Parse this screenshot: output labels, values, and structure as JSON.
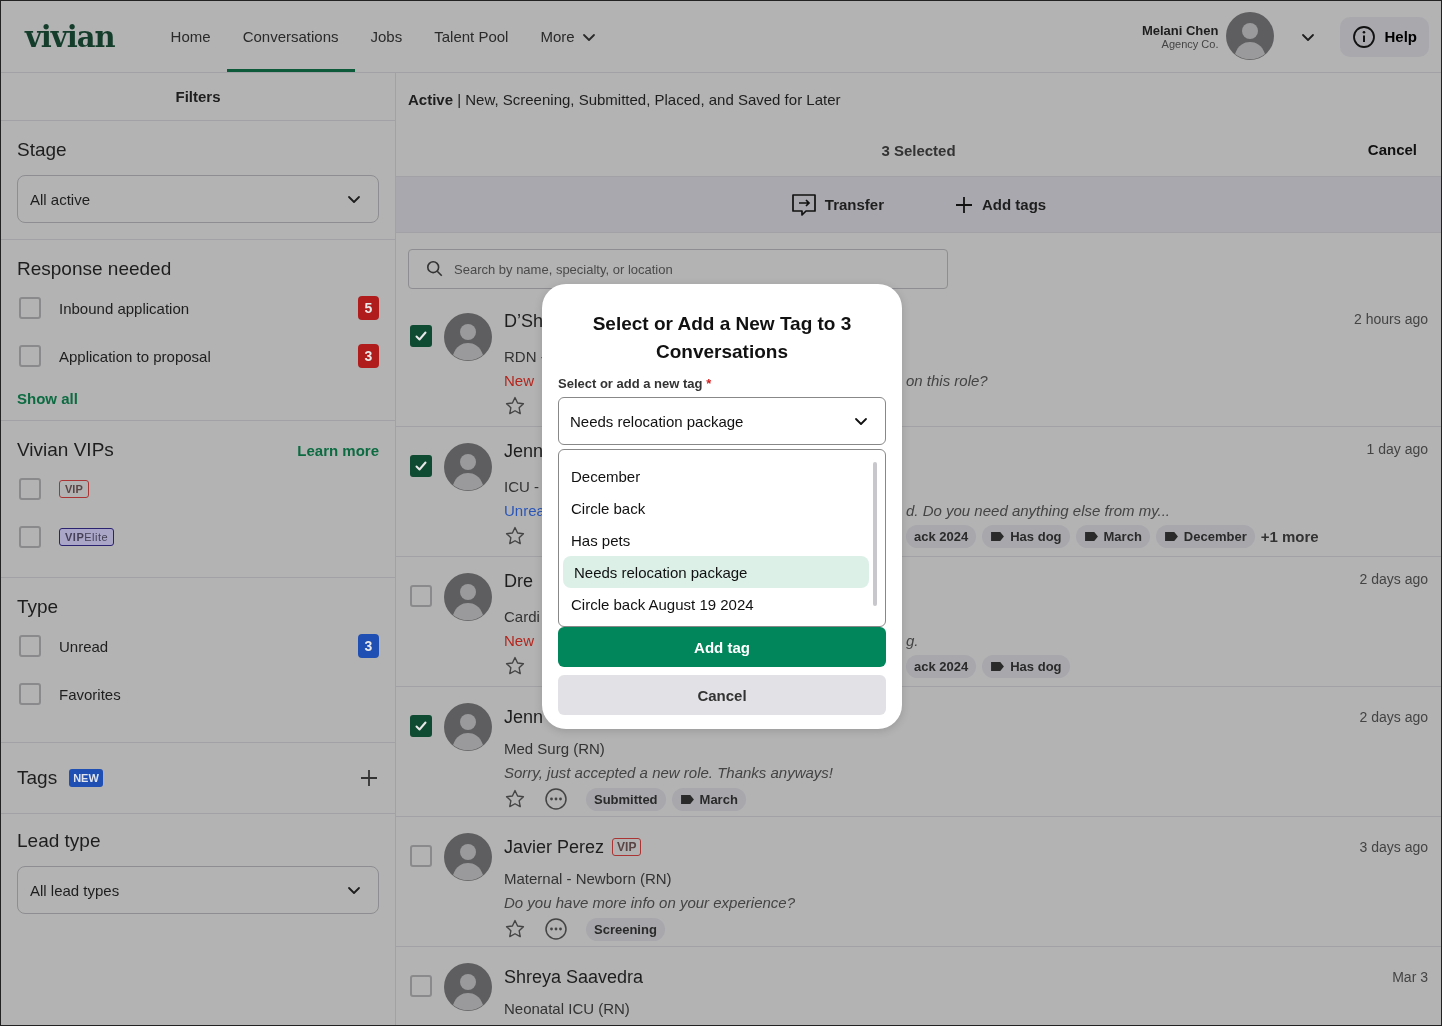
{
  "header": {
    "logo": "vivian",
    "nav": [
      {
        "label": "Home",
        "selected": false,
        "kind": "link"
      },
      {
        "label": "Conversations",
        "selected": true,
        "kind": "link"
      },
      {
        "label": "Jobs",
        "selected": false,
        "kind": "link"
      },
      {
        "label": "Talent Pool",
        "selected": false,
        "kind": "link"
      },
      {
        "label": "More",
        "selected": false,
        "kind": "menu"
      }
    ],
    "user": {
      "name": "Melani Chen",
      "org": "Agency Co."
    },
    "help": "Help"
  },
  "filters": {
    "title": "Filters",
    "stage": {
      "heading": "Stage",
      "value": "All active"
    },
    "response_needed": {
      "heading": "Response needed",
      "link": "Show all",
      "items": [
        {
          "label": "Inbound application",
          "checked": false,
          "count": "5",
          "color": "#b01c1c"
        },
        {
          "label": "Application to proposal",
          "checked": false,
          "count": "3",
          "color": "#b01c1c"
        }
      ]
    },
    "vips": {
      "heading": "Vivian VIPs",
      "link": "Learn more",
      "items": [
        {
          "label": "VIP",
          "checked": false,
          "kind": "vip"
        },
        {
          "label": "**VIP**Elite",
          "checked": false,
          "kind": "elite"
        }
      ]
    },
    "type": {
      "heading": "Type",
      "items": [
        {
          "label": "Unread",
          "checked": false,
          "count": "3",
          "color": "#1f4fb3"
        },
        {
          "label": "Favorites",
          "checked": false
        }
      ]
    },
    "tags": {
      "heading": "Tags",
      "badge": "NEW"
    },
    "lead_type": {
      "heading": "Lead type",
      "value": "All lead types"
    }
  },
  "main": {
    "breadcrumb": "**Active** | New, Screening, Submitted, Placed, and Saved for Later",
    "selection": {
      "count": "3 Selected",
      "cancel": "Cancel"
    },
    "actions": [
      {
        "label": "Transfer",
        "kind": "transfer"
      },
      {
        "label": "Add tags",
        "kind": "add"
      }
    ],
    "search": {
      "placeholder": "Search by name, specialty, or location"
    },
    "conversations": [
      {
        "kind": "covered",
        "selected": true,
        "starred": false,
        "name": "D’Sh",
        "subtitle": "RDN -",
        "status": {
          "text": "New",
          "color": "#b3261e"
        },
        "message": "on this role?",
        "time": "2 hours ago"
      },
      {
        "kind": "covered",
        "selected": true,
        "starred": false,
        "name": "Jenn",
        "subtitle": "ICU -",
        "status": {
          "text": "Unrea",
          "color": "#2a56b8"
        },
        "message": "d. Do you need anything else from my...",
        "time": "1 day ago",
        "tags": [
          {
            "label": "ack 2024",
            "kind": "stage"
          },
          {
            "label": "Has dog",
            "kind": "label"
          },
          {
            "label": "March",
            "kind": "label"
          },
          {
            "label": "December",
            "kind": "label"
          }
        ],
        "more": "+1 more"
      },
      {
        "kind": "covered",
        "selected": false,
        "starred": false,
        "name": "Dre",
        "subtitle": "Cardi",
        "status": {
          "text": "New",
          "color": "#b3261e"
        },
        "message": "g.",
        "time": "2 days ago",
        "tags": [
          {
            "label": "ack 2024",
            "kind": "stage"
          },
          {
            "label": "Has dog",
            "kind": "label"
          }
        ]
      },
      {
        "kind": "full",
        "selected": true,
        "starred": false,
        "name": "Jenn",
        "subtitle": "Med Surg (RN)",
        "message": "Sorry, just accepted a new role. Thanks anyways!",
        "time": "2 days ago",
        "tags": [
          {
            "label": "Submitted",
            "kind": "stage"
          },
          {
            "label": "March",
            "kind": "label"
          }
        ]
      },
      {
        "kind": "full",
        "selected": false,
        "starred": false,
        "name": "Javier Perez",
        "badge": "VIP",
        "subtitle": "Maternal - Newborn (RN)",
        "message": "Do you have more info on your experience?",
        "time": "3 days ago",
        "tags": [
          {
            "label": "Screening",
            "kind": "stage"
          }
        ]
      },
      {
        "kind": "full",
        "selected": false,
        "name": "Shreya Saavedra",
        "subtitle": "Neonatal ICU (RN)",
        "time": "Mar 3"
      }
    ]
  },
  "dialog": {
    "title": "Select or Add a New Tag to 3 Conversations",
    "label": "Select or add a new tag",
    "required": "*",
    "value": "Needs relocation package",
    "options": [
      {
        "label": "December",
        "selected": false
      },
      {
        "label": "Circle back",
        "selected": false
      },
      {
        "label": "Has pets",
        "selected": false
      },
      {
        "label": "Needs relocation package",
        "selected": true
      },
      {
        "label": "Circle back August 19 2024",
        "selected": false
      }
    ],
    "confirm": "Add tag",
    "cancel": "Cancel"
  }
}
